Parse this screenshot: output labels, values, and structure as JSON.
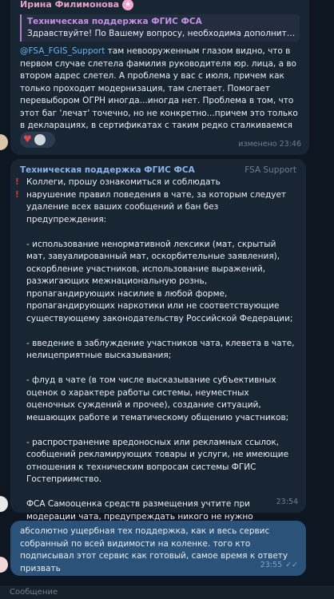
{
  "messages": [
    {
      "sender": "Ирина Филимонова",
      "reply_to": {
        "title": "Техническая поддержка ФГИС ФСА",
        "text": "Здравствуйте! По Вашему вопросу, необходима дополнител..."
      },
      "mention": "@FSA_FGIS_Support",
      "text": " там невооруженным глазом видно, что в первом случае слетела фамилия руководителя юр. лица, а во втором адрес слетел. А проблема у вас с июля, причем как только проходит модернизация, там слетает. Помогает перевыбором ОГРН иногда...иногда нет. Проблема в том, что этот баг 'лечат' точечно, но не конкретно...причем это только в декларациях, в сертификатах с таким редко сталкиваемся",
      "meta": "изменено 23:46",
      "reaction": "♥"
    },
    {
      "sender": "Техническая поддержка ФГИС ФСА",
      "role": "FSA Support",
      "warn_icon": "!",
      "text": "Коллеги, прошу ознакомиться и соблюдать\nнарушение правил поведения в чате, за которым следует удаление всех ваших сообщений и бан без предупреждения:\n\n- использование ненормативной лексики (мат, скрытый мат, завуалированный мат, оскорбительные заявления), оскорбление участников, использование выражений, разжигающих межнациональную рознь, пропагандирующих насилие в любой форме, пропагандирующих наркотики или не соответствующие существующему законодательству Российской Федерации;\n\n- введение в заблуждение участников чата, клевета в чате, нелицеприятные высказывания;\n\n- флуд в чате (в том числе высказывание субъективных оценок о характере работы системы, неуместных оценочных суждений и прочее), создание ситуаций, мешающих работе и тематическому общению участников;\n\n- распространение вредоносных или рекламных ссылок, сообщений рекламирующих товары и услуги, не имеющие отношения к техническим вопросам системы ФГИС Гостеприимство.\n\nФСА Самооценка средств размещения учтите при модерации чата, предупреждать никого не нужно",
      "meta": "23:54"
    },
    {
      "text": "абсолютно ущербная тех поддержка, как и весь сервис собранный по всей видимости на коленке. того кто подписывал этот сервис как готовый, самое время к ответу призвать",
      "meta": "23:55",
      "status_icon": "✓✓"
    }
  ],
  "input": {
    "placeholder": "Сообщение"
  },
  "colors": {
    "background": "#0e1621",
    "bubble_in": "#182533",
    "bubble_out": "#2b5278",
    "accent": "#6ab3f3"
  }
}
